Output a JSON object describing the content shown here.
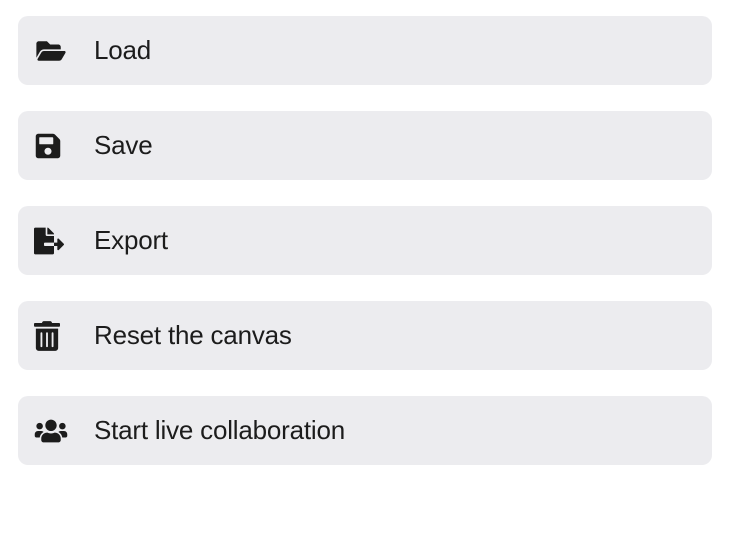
{
  "menu": {
    "items": [
      {
        "label": "Load"
      },
      {
        "label": "Save"
      },
      {
        "label": "Export"
      },
      {
        "label": "Reset the canvas"
      },
      {
        "label": "Start live collaboration"
      }
    ]
  }
}
